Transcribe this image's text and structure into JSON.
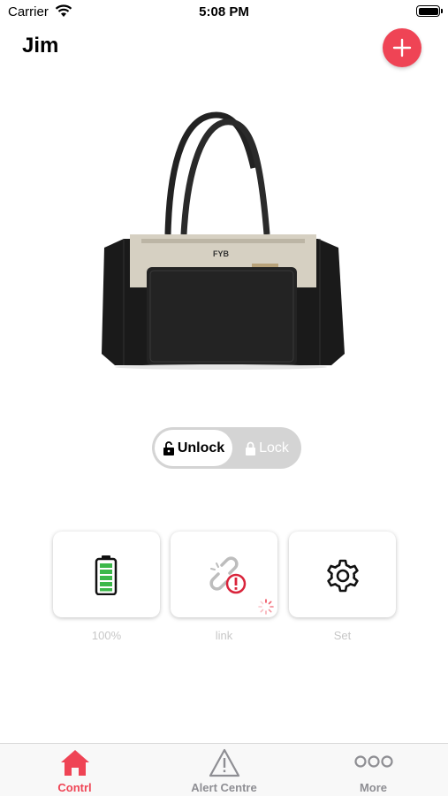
{
  "status_bar": {
    "carrier": "Carrier",
    "time": "5:08 PM"
  },
  "header": {
    "title": "Jim",
    "add_icon": "plus-icon",
    "accent_color": "#ef4455"
  },
  "product": {
    "image": "handbag",
    "brand_text": "FYB"
  },
  "lock_toggle": {
    "unlock_label": "Unlock",
    "lock_label": "Lock",
    "selected": "Unlock"
  },
  "tiles": [
    {
      "id": "battery",
      "icon": "battery-icon",
      "label": "100%"
    },
    {
      "id": "link",
      "icon": "broken-link-icon",
      "label": "link"
    },
    {
      "id": "settings",
      "icon": "gear-icon",
      "label": "Set"
    }
  ],
  "tab_bar": {
    "tabs": [
      {
        "label": "Contrl",
        "icon": "home-icon",
        "active": true
      },
      {
        "label": "Alert Centre",
        "icon": "warning-icon",
        "active": false
      },
      {
        "label": "More",
        "icon": "more-icon",
        "active": false
      }
    ]
  }
}
